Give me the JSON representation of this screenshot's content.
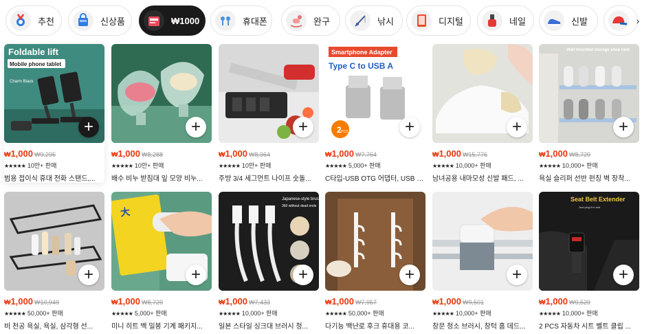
{
  "categories": [
    {
      "label": "추천",
      "icon": "medal-icon"
    },
    {
      "label": "신상품",
      "icon": "shopping-bag-icon"
    },
    {
      "label": "₩1000",
      "icon": "price-tag-icon",
      "active": true
    },
    {
      "label": "휴대폰",
      "icon": "earphones-icon"
    },
    {
      "label": "완구",
      "icon": "rocking-horse-icon"
    },
    {
      "label": "낚시",
      "icon": "fishing-rod-icon"
    },
    {
      "label": "디지털",
      "icon": "tablet-icon"
    },
    {
      "label": "네일",
      "icon": "nail-polish-icon"
    },
    {
      "label": "신발",
      "icon": "sneaker-icon"
    },
    {
      "label": "",
      "icon": "cap-icon"
    }
  ],
  "more_symbol": "›",
  "plus_symbol": "+",
  "currency": "₩",
  "stars": "★★★★★",
  "accent_color": "#e8360e",
  "products": [
    {
      "price": "1,000",
      "orig": "₩9,295",
      "sold": "10만+ 판매",
      "title": "범용 접이식 휴대 전화 스탠드,...",
      "image_text": {
        "headline": "Foldable lift",
        "tag": "Mobile phone tablet",
        "color": "Charm Black"
      }
    },
    {
      "price": "1,000",
      "orig": "₩8,288",
      "sold": "10만+ 판매",
      "title": "배수 비누 받침대 잎 모양 비누..."
    },
    {
      "price": "1,000",
      "orig": "₩8,964",
      "sold": "10만+ 판매",
      "title": "주방 3/4 세그먼트 나이프 숫돌..."
    },
    {
      "price": "1,000",
      "orig": "₩7,764",
      "sold": "5,000+ 판매",
      "title": "C타입-USB OTG 어댑터, USB C...",
      "image_text": {
        "banner": "Smartphone Adapter",
        "headline": "Type C to USB A",
        "badge": "2",
        "badge_unit": "PCS"
      }
    },
    {
      "price": "1,000",
      "orig": "₩15,776",
      "sold": "10,000+ 판매",
      "title": "남녀공용 내마모성 신발 패드, ..."
    },
    {
      "price": "1,000",
      "orig": "₩8,729",
      "sold": "10,000+ 판매",
      "title": "욕실 슬리퍼 선반 펀칭 벽 장착...",
      "image_text": {
        "headline": "Wall mounted storage shoe rack"
      }
    },
    {
      "price": "1,000",
      "orig": "₩10,949",
      "sold": "50,000+ 판매",
      "title": "비 천공 욕실, 욕실, 삼각형 선..."
    },
    {
      "price": "1,000",
      "orig": "₩8,729",
      "sold": "5,000+ 판매",
      "title": "미니 히트 백 밀봉 기계 패키지..."
    },
    {
      "price": "1,000",
      "orig": "₩7,433",
      "sold": "10,000+ 판매",
      "title": "일본 스타일 싱크대 브러시 청...",
      "image_text": {
        "headline": "Japanese-style brush",
        "sub": "360 without dead ends"
      }
    },
    {
      "price": "1,000",
      "orig": "₩7,957",
      "sold": "50,000+ 판매",
      "title": "다기능 백난로 후크 휴대용 코..."
    },
    {
      "price": "1,000",
      "orig": "₩9,501",
      "sold": "10,000+ 판매",
      "title": "창문 청소 브러시, 창턱 홈 데드..."
    },
    {
      "price": "1,000",
      "orig": "₩9,529",
      "sold": "10,000+ 판매",
      "title": "2 PCS 자동차 시트 벨트 클립 ...",
      "image_text": {
        "headline": "Seat Belt Extender",
        "sub": "Just plug it in and use it without affecting the original function"
      }
    }
  ]
}
